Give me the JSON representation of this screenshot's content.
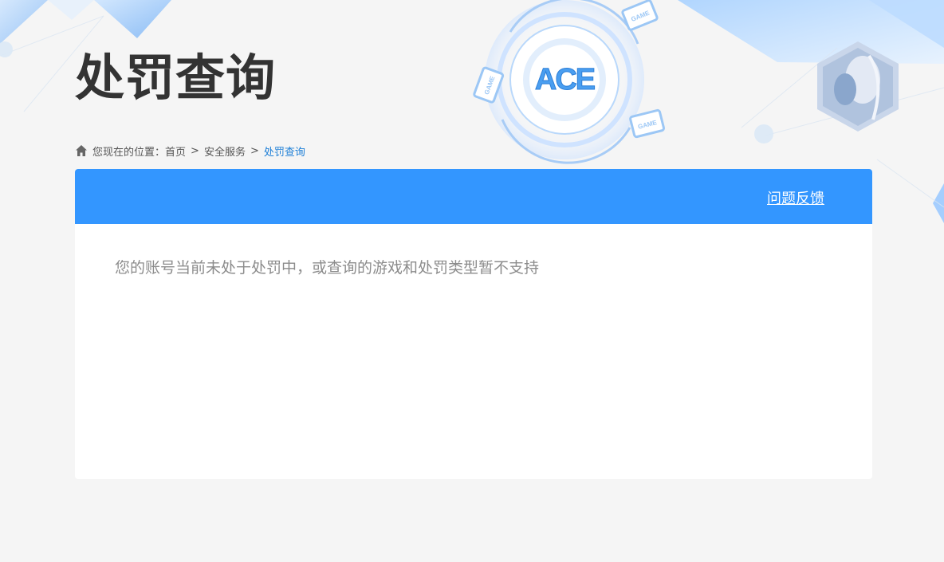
{
  "page": {
    "title": "处罚查询"
  },
  "breadcrumb": {
    "prefix": "您现在的位置：",
    "items": [
      "首页",
      "安全服务",
      "处罚查询"
    ],
    "separator": ">"
  },
  "card": {
    "feedback_label": "问题反馈",
    "message": "您的账号当前未处于处罚中，或查询的游戏和处罚类型暂不支持"
  },
  "decoration": {
    "logo_text": "ACE",
    "badge_text": "GAME"
  },
  "colors": {
    "accent": "#3396ff",
    "breadcrumb_current": "#1c7ed6",
    "title": "#333333",
    "message": "#8c8c8c",
    "background": "#f5f5f5"
  }
}
